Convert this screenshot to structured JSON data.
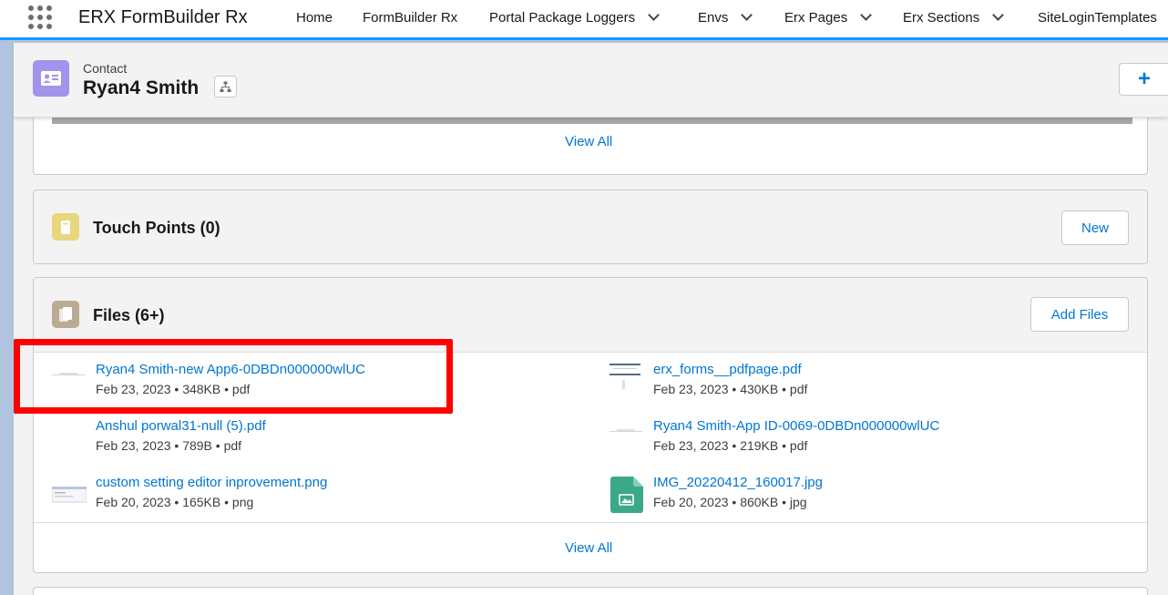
{
  "app": {
    "name": "ERX FormBuilder Rx"
  },
  "nav": {
    "items": [
      {
        "label": "Home",
        "has_menu": false
      },
      {
        "label": "FormBuilder Rx",
        "has_menu": false
      },
      {
        "label": "Portal Package Loggers",
        "has_menu": true
      },
      {
        "label": "Envs",
        "has_menu": true
      },
      {
        "label": "Erx Pages",
        "has_menu": true
      },
      {
        "label": "Erx Sections",
        "has_menu": true
      },
      {
        "label": "SiteLoginTemplates",
        "has_menu": false
      }
    ]
  },
  "record": {
    "type": "Contact",
    "name": "Ryan4 Smith",
    "icon": "contact-card-icon",
    "icon_color": "#a094ed"
  },
  "prev_card": {
    "view_all": "View All"
  },
  "touch_points": {
    "title": "Touch Points (0)",
    "icon": "touch-points-icon",
    "icon_color": "#e8d77f",
    "new_button": "New"
  },
  "files": {
    "title": "Files (6+)",
    "icon": "files-icon",
    "icon_color": "#baac93",
    "add_button": "Add Files",
    "items": [
      {
        "name": "Ryan4 Smith-new App6-0DBDn000000wlUC",
        "meta": "Feb 23, 2023 • 348KB • pdf",
        "thumb": "doc-thumb-icon"
      },
      {
        "name": "erx_forms__pdfpage.pdf",
        "meta": "Feb 23, 2023 • 430KB • pdf",
        "thumb": "pdf-thumb-icon"
      },
      {
        "name": "Anshul porwal31-null (5).pdf",
        "meta": "Feb 23, 2023 • 789B • pdf",
        "thumb": "blank-thumb"
      },
      {
        "name": "Ryan4 Smith-App ID-0069-0DBDn000000wlUC",
        "meta": "Feb 23, 2023 • 219KB • pdf",
        "thumb": "doc-thumb-icon"
      },
      {
        "name": "custom setting editor inprovement.png",
        "meta": "Feb 20, 2023 • 165KB • png",
        "thumb": "screenshot-thumb-icon"
      },
      {
        "name": "IMG_20220412_160017.jpg",
        "meta": "Feb 20, 2023 • 860KB • jpg",
        "thumb": "image-file-icon"
      }
    ],
    "view_all": "View All"
  },
  "colors": {
    "link": "#0176d3",
    "highlight": "#ff0000",
    "nav_border": "#1b96ff",
    "image_icon": "#3ba889"
  }
}
